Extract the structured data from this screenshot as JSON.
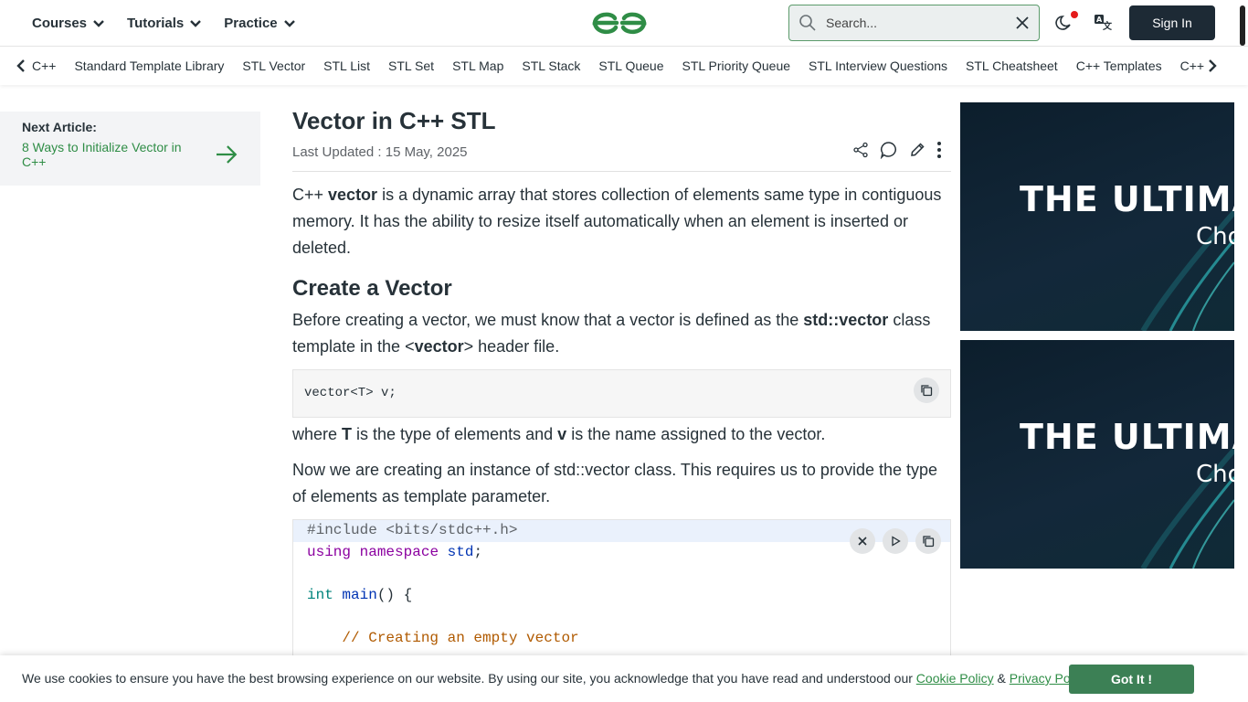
{
  "header": {
    "menus": [
      "Courses",
      "Tutorials",
      "Practice"
    ],
    "search_placeholder": "Search...",
    "signin_label": "Sign In"
  },
  "subnav": {
    "items": [
      "C++",
      "Standard Template Library",
      "STL Vector",
      "STL List",
      "STL Set",
      "STL Map",
      "STL Stack",
      "STL Queue",
      "STL Priority Queue",
      "STL Interview Questions",
      "STL Cheatsheet",
      "C++ Templates",
      "C++ Functor"
    ]
  },
  "sidebar": {
    "next_label": "Next Article:",
    "next_link": "8 Ways to Initialize Vector in C++"
  },
  "article": {
    "title": "Vector in C++ STL",
    "updated": "Last Updated : 15 May, 2025",
    "intro_pre": "C++ ",
    "intro_bold": "vector",
    "intro_post": " is a dynamic array that stores collection of elements same type in contiguous memory. It has the ability to resize itself automatically when an element is inserted or deleted.",
    "h2_create": "Create a Vector",
    "p2_pre": "Before creating a vector, we must know that a vector is defined as the ",
    "p2_bold1": "std::vector",
    "p2_mid": " class template in the <",
    "p2_bold2": "vector",
    "p2_post": "> header file.",
    "code_simple": "vector<T> v;",
    "p3_pre": "where ",
    "p3_b1": "T",
    "p3_mid": " is the type of elements and ",
    "p3_b2": "v",
    "p3_post": " is the name assigned to the vector.",
    "p4": "Now we are creating an instance of std::vector class. This requires us to provide the type of elements as template parameter.",
    "code_lines": {
      "l1": "#include <bits/stdc++.h>",
      "l2_kw1": "using",
      "l2_kw2": "namespace",
      "l2_ns": "std",
      "l2_end": ";",
      "l4_type": "int",
      "l4_fn": "main",
      "l4_end": "() {",
      "l6_comment": "// Creating an empty vector"
    }
  },
  "ads": {
    "headline": "THE ULTIMATE",
    "sub": "Choose"
  },
  "cookie": {
    "message": "We use cookies to ensure you have the best browsing experience on our website. By using our site, you acknowledge that you have read and understood our ",
    "cookie_policy": "Cookie Policy",
    "amp": " & ",
    "privacy_policy": "Privacy Policy",
    "button": "Got It !"
  },
  "colors": {
    "brand_green": "#2f8d46",
    "dark": "#1d2a35"
  }
}
